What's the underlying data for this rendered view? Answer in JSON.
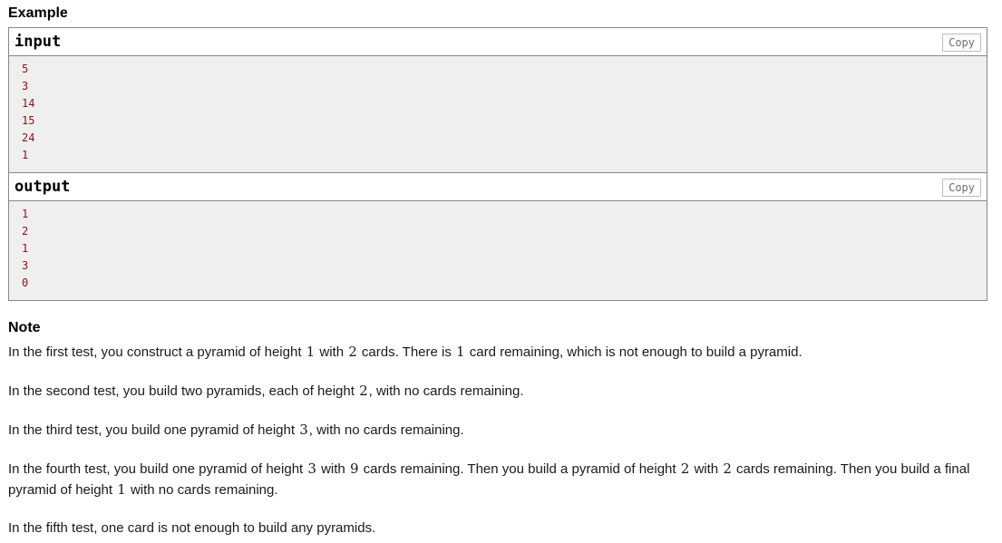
{
  "example": {
    "heading": "Example",
    "copy_label": "Copy",
    "blocks": [
      {
        "title": "input",
        "lines": [
          "5",
          "3",
          "14",
          "15",
          "24",
          "1"
        ],
        "text": "5\n3\n14\n15\n24\n1"
      },
      {
        "title": "output",
        "lines": [
          "1",
          "2",
          "1",
          "3",
          "0"
        ],
        "text": "1\n2\n1\n3\n0"
      }
    ]
  },
  "note": {
    "heading": "Note",
    "paragraphs": [
      {
        "id": "first-test",
        "parts": [
          {
            "t": "text",
            "v": "In the first test, you construct a pyramid of height "
          },
          {
            "t": "math",
            "v": "1"
          },
          {
            "t": "text",
            "v": " with "
          },
          {
            "t": "math",
            "v": "2"
          },
          {
            "t": "text",
            "v": " cards. There is "
          },
          {
            "t": "math",
            "v": "1"
          },
          {
            "t": "text",
            "v": " card remaining, which is not enough to build a pyramid."
          }
        ]
      },
      {
        "id": "second-test",
        "parts": [
          {
            "t": "text",
            "v": "In the second test, you build two pyramids, each of height "
          },
          {
            "t": "math",
            "v": "2"
          },
          {
            "t": "text",
            "v": ", with no cards remaining."
          }
        ]
      },
      {
        "id": "third-test",
        "parts": [
          {
            "t": "text",
            "v": "In the third test, you build one pyramid of height "
          },
          {
            "t": "math",
            "v": "3"
          },
          {
            "t": "text",
            "v": ", with no cards remaining."
          }
        ]
      },
      {
        "id": "fourth-test",
        "parts": [
          {
            "t": "text",
            "v": "In the fourth test, you build one pyramid of height "
          },
          {
            "t": "math",
            "v": "3"
          },
          {
            "t": "text",
            "v": " with "
          },
          {
            "t": "math",
            "v": "9"
          },
          {
            "t": "text",
            "v": " cards remaining. Then you build a pyramid of height "
          },
          {
            "t": "math",
            "v": "2"
          },
          {
            "t": "text",
            "v": " with "
          },
          {
            "t": "math",
            "v": "2"
          },
          {
            "t": "text",
            "v": " cards remaining. Then you build a final pyramid of height "
          },
          {
            "t": "math",
            "v": "1"
          },
          {
            "t": "text",
            "v": " with no cards remaining."
          }
        ]
      },
      {
        "id": "fifth-test",
        "parts": [
          {
            "t": "text",
            "v": "In the fifth test, one card is not enough to build any pyramids."
          }
        ]
      }
    ]
  },
  "colors": {
    "sample_text": "#8e1414",
    "sample_background": "#efefef",
    "border": "#888888",
    "page_background": "#ffffff",
    "body_text": "#1a1a1a"
  }
}
